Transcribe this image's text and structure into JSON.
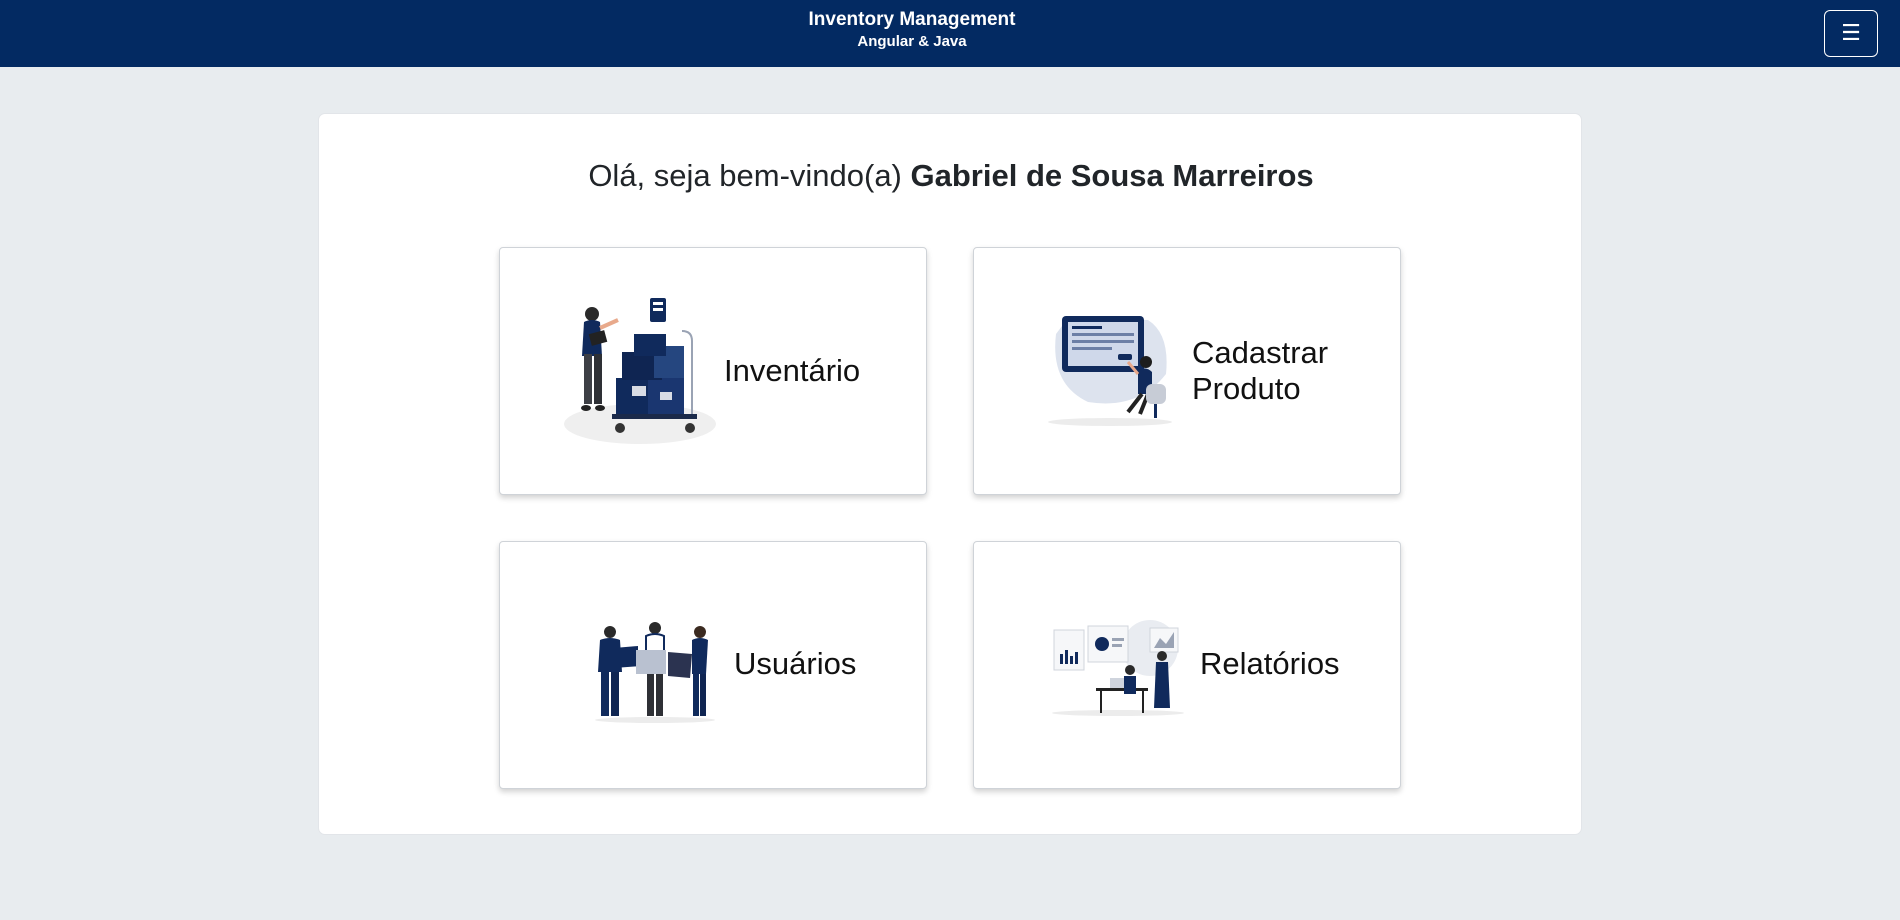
{
  "header": {
    "title": "Inventory Management",
    "subtitle": "Angular & Java",
    "menu_icon": "hamburger-menu-icon",
    "background": "#032a62"
  },
  "welcome": {
    "greeting": "Olá, seja bem-vindo(a)",
    "user_name": "Gabriel de Sousa Marreiros"
  },
  "cards": [
    {
      "label": "Inventário",
      "icon": "inventory-illustration"
    },
    {
      "label_line1": "Cadastrar",
      "label_line2": "Produto",
      "icon": "product-register-illustration"
    },
    {
      "label": "Usuários",
      "icon": "users-illustration"
    },
    {
      "label": "Relatórios",
      "icon": "reports-illustration"
    }
  ],
  "colors": {
    "accent": "#032a62",
    "illustration_dark": "#102a5c",
    "page_background": "#e8ecef"
  }
}
